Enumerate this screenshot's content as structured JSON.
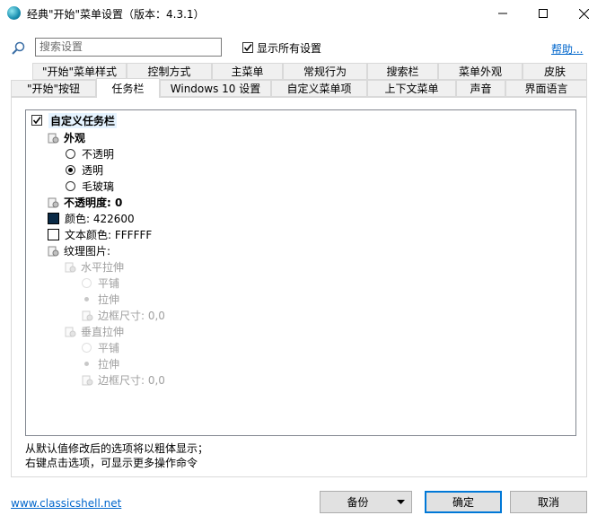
{
  "window": {
    "title": "经典\"开始\"菜单设置（版本：4.3.1）"
  },
  "search": {
    "placeholder": "搜索设置",
    "show_all_label": "显示所有设置",
    "show_all_checked": true,
    "help_link": "帮助..."
  },
  "tabs": {
    "row1": [
      "\"开始\"菜单样式",
      "控制方式",
      "主菜单",
      "常规行为",
      "搜索栏",
      "菜单外观",
      "皮肤"
    ],
    "row2": [
      "\"开始\"按钮",
      "任务栏",
      "Windows 10 设置",
      "自定义菜单项",
      "上下文菜单",
      "声音",
      "界面语言"
    ],
    "active": "任务栏"
  },
  "tree": {
    "root": {
      "label": "自定义任务栏",
      "checked": true
    },
    "appearance": {
      "label": "外观"
    },
    "options": [
      "不透明",
      "透明",
      "毛玻璃"
    ],
    "selected_option": "透明",
    "opacity": "不透明度: 0",
    "color": {
      "label": "颜色: 422600",
      "swatch": "#0a2a46"
    },
    "text_color": {
      "label": "文本颜色: FFFFFF",
      "swatch": "#ffffff"
    },
    "texture": "纹理图片:",
    "horizontal_stretch": "水平拉伸",
    "h_tile": "平铺",
    "h_stretch": "拉伸",
    "h_border": "边框尺寸: 0,0",
    "vertical_stretch": "垂直拉伸",
    "v_tile": "平铺",
    "v_stretch": "拉伸",
    "v_border": "边框尺寸: 0,0"
  },
  "info": {
    "line1": "从默认值修改后的选项将以粗体显示；",
    "line2": "右键点击选项，可显示更多操作命令"
  },
  "footer": {
    "website": "www.classicshell.net",
    "backup_label": "备份",
    "ok_label": "确定",
    "cancel_label": "取消"
  },
  "colors": {
    "link": "#0066cc",
    "accent": "#0078d7"
  }
}
